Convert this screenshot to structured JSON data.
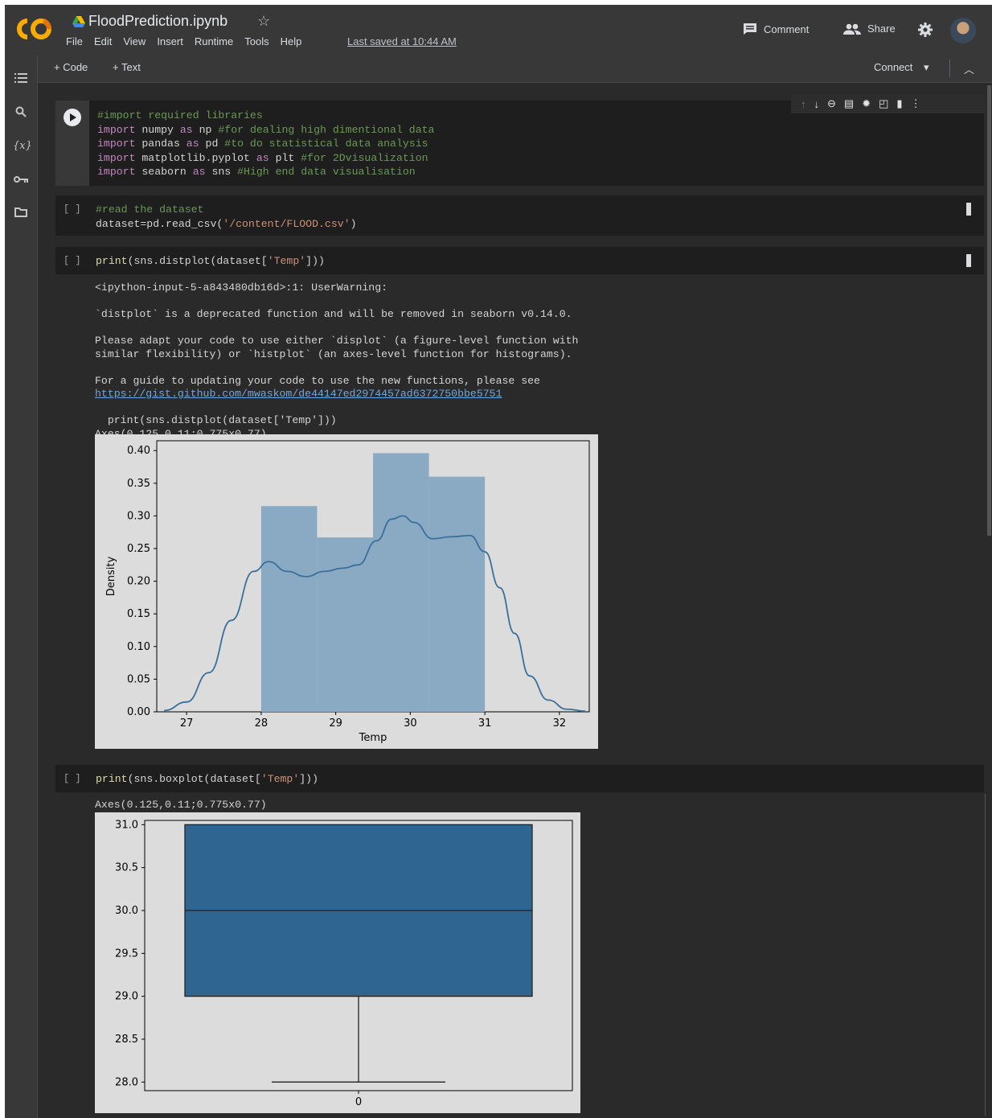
{
  "header": {
    "title": "FloodPrediction.ipynb",
    "menu": [
      "File",
      "Edit",
      "View",
      "Insert",
      "Runtime",
      "Tools",
      "Help"
    ],
    "last_saved": "Last saved at 10:44 AM",
    "comment_label": "Comment",
    "share_label": "Share"
  },
  "toolbar": {
    "add_code": "+ Code",
    "add_text": "+ Text",
    "connect": "Connect"
  },
  "cells": {
    "c1": {
      "lines": [
        [
          [
            "cm",
            "#import required libraries"
          ]
        ],
        [
          [
            "kw",
            "import"
          ],
          [
            "pl",
            " numpy "
          ],
          [
            "kw",
            "as"
          ],
          [
            "pl",
            " np "
          ],
          [
            "cm",
            "#for dealing high dimentional data"
          ]
        ],
        [
          [
            "kw",
            "import"
          ],
          [
            "pl",
            " pandas "
          ],
          [
            "kw",
            "as"
          ],
          [
            "pl",
            " pd "
          ],
          [
            "cm",
            "#to do statistical data analysis"
          ]
        ],
        [
          [
            "kw",
            "import"
          ],
          [
            "pl",
            " matplotlib.pyplot "
          ],
          [
            "kw",
            "as"
          ],
          [
            "pl",
            " plt "
          ],
          [
            "cm",
            "#for 2Dvisualization"
          ]
        ],
        [
          [
            "kw",
            "import"
          ],
          [
            "pl",
            " seaborn "
          ],
          [
            "kw",
            "as"
          ],
          [
            "pl",
            " sns "
          ],
          [
            "cm",
            "#High end data visualisation"
          ]
        ]
      ]
    },
    "c2": {
      "bracket": "[ ]",
      "lines": [
        [
          [
            "cm",
            "#read the dataset"
          ]
        ],
        [
          [
            "pl",
            "dataset=pd.read_csv("
          ],
          [
            "str",
            "'/content/FLOOD.csv'"
          ],
          [
            "pl",
            ")"
          ]
        ]
      ]
    },
    "c3": {
      "bracket": "[ ]",
      "code": [
        [
          "fn",
          "print"
        ],
        [
          "pl",
          "(sns.distplot(dataset["
        ],
        [
          "str",
          "'Temp'"
        ],
        [
          "pl",
          "]))"
        ]
      ],
      "output_lines": [
        "<ipython-input-5-a843480db16d>:1: UserWarning:",
        "",
        "`distplot` is a deprecated function and will be removed in seaborn v0.14.0.",
        "",
        "Please adapt your code to use either `displot` (a figure-level function with",
        "similar flexibility) or `histplot` (an axes-level function for histograms).",
        "",
        "For a guide to updating your code to use the new functions, please see"
      ],
      "link": "https://gist.github.com/mwaskom/de44147ed2974457ad6372750bbe5751",
      "output_after": [
        "",
        "  print(sns.distplot(dataset['Temp']))",
        "Axes(0.125,0.11;0.775x0.77)"
      ]
    },
    "c4": {
      "bracket": "[ ]",
      "code": [
        [
          "fn",
          "print"
        ],
        [
          "pl",
          "(sns.boxplot(dataset["
        ],
        [
          "str",
          "'Temp'"
        ],
        [
          "pl",
          "]))"
        ]
      ],
      "output": "Axes(0.125,0.11;0.775x0.77)"
    }
  },
  "chart_data": [
    {
      "type": "bar",
      "subtype": "histogram-with-kde",
      "xlabel": "Temp",
      "ylabel": "Density",
      "xlim": [
        26.6,
        32.4
      ],
      "ylim": [
        0,
        0.415
      ],
      "xticks": [
        27,
        28,
        29,
        30,
        31,
        32
      ],
      "yticks": [
        0.0,
        0.05,
        0.1,
        0.15,
        0.2,
        0.25,
        0.3,
        0.35,
        0.4
      ],
      "bins": [
        {
          "x0": 28.0,
          "x1": 28.75,
          "value": 0.315
        },
        {
          "x0": 28.75,
          "x1": 29.5,
          "value": 0.267
        },
        {
          "x0": 29.5,
          "x1": 30.25,
          "value": 0.396
        },
        {
          "x0": 30.25,
          "x1": 31.0,
          "value": 0.36
        }
      ],
      "kde": {
        "x": [
          26.7,
          27.0,
          27.3,
          27.6,
          27.9,
          28.1,
          28.35,
          28.6,
          28.85,
          29.1,
          29.3,
          29.55,
          29.75,
          29.9,
          30.05,
          30.3,
          30.55,
          30.8,
          31.0,
          31.2,
          31.4,
          31.6,
          31.85,
          32.1,
          32.35
        ],
        "y": [
          0.002,
          0.015,
          0.06,
          0.14,
          0.215,
          0.23,
          0.215,
          0.207,
          0.215,
          0.22,
          0.225,
          0.262,
          0.295,
          0.3,
          0.29,
          0.265,
          0.268,
          0.27,
          0.245,
          0.19,
          0.12,
          0.055,
          0.018,
          0.004,
          0.001
        ]
      },
      "bar_color": "#8aaac4",
      "line_color": "#3a6f9a"
    },
    {
      "type": "boxplot",
      "categories": [
        "0"
      ],
      "ylim": [
        27.9,
        31.05
      ],
      "yticks": [
        28.0,
        28.5,
        29.0,
        29.5,
        30.0,
        30.5,
        31.0
      ],
      "min": 28.0,
      "q1": 29.0,
      "median": 30.0,
      "q3": 31.0,
      "max": 31.0,
      "box_color": "#2f6591"
    }
  ]
}
